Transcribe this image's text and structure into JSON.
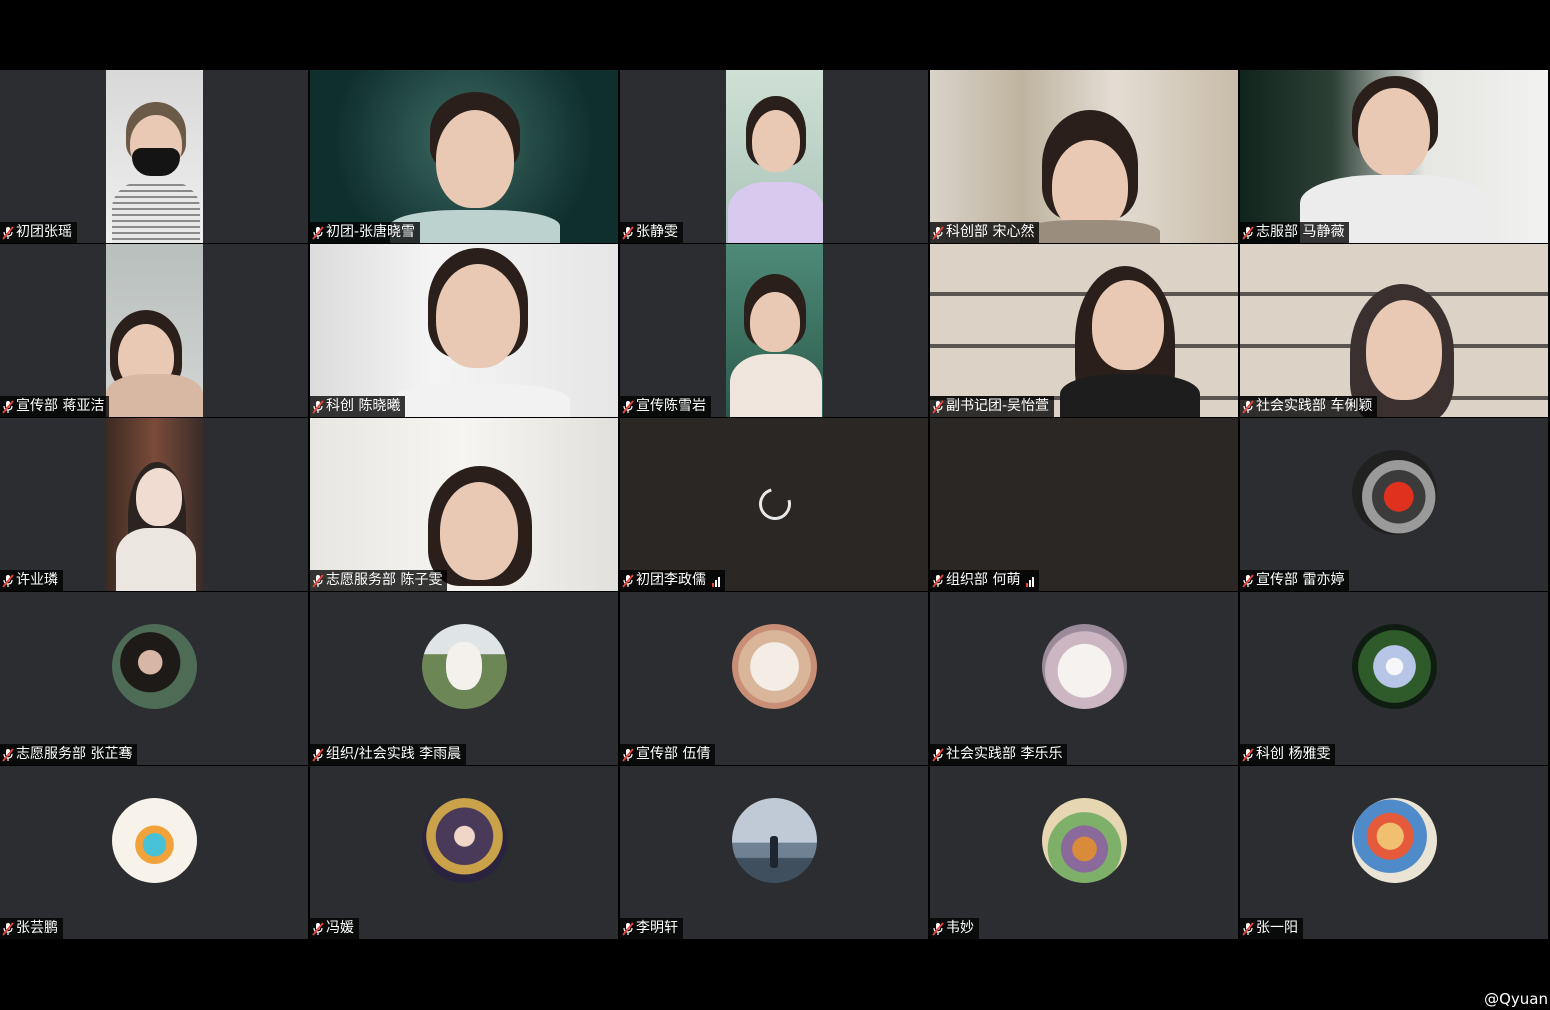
{
  "participants": [
    {
      "name": "初团张瑶"
    },
    {
      "name": "初团-张唐晓雪"
    },
    {
      "name": "张静雯"
    },
    {
      "name": "科创部 宋心然"
    },
    {
      "name": "志服部 马静薇"
    },
    {
      "name": "宣传部 蒋亚洁"
    },
    {
      "name": "科创 陈晓曦"
    },
    {
      "name": "宣传陈雪岩"
    },
    {
      "name": "副书记团-吴怡萱"
    },
    {
      "name": "社会实践部 车俐颖"
    },
    {
      "name": "许业璘"
    },
    {
      "name": "志愿服务部 陈子雯"
    },
    {
      "name": "初团李政儒"
    },
    {
      "name": "组织部 何萌"
    },
    {
      "name": "宣传部 雷亦婷"
    },
    {
      "name": "志愿服务部 张芷骞"
    },
    {
      "name": "组织/社会实践 李雨晨"
    },
    {
      "name": "宣传部 伍倩"
    },
    {
      "name": "社会实践部 李乐乐"
    },
    {
      "name": "科创 杨雅雯"
    },
    {
      "name": "张芸鹏"
    },
    {
      "name": "冯媛"
    },
    {
      "name": "李明轩"
    },
    {
      "name": "韦妙"
    },
    {
      "name": "张一阳"
    }
  ],
  "watermark": "@Qyuan",
  "colors": {
    "tile_bg": "#2b2d30",
    "label_bg": "#000000",
    "muted_mic": "#e8453c"
  }
}
